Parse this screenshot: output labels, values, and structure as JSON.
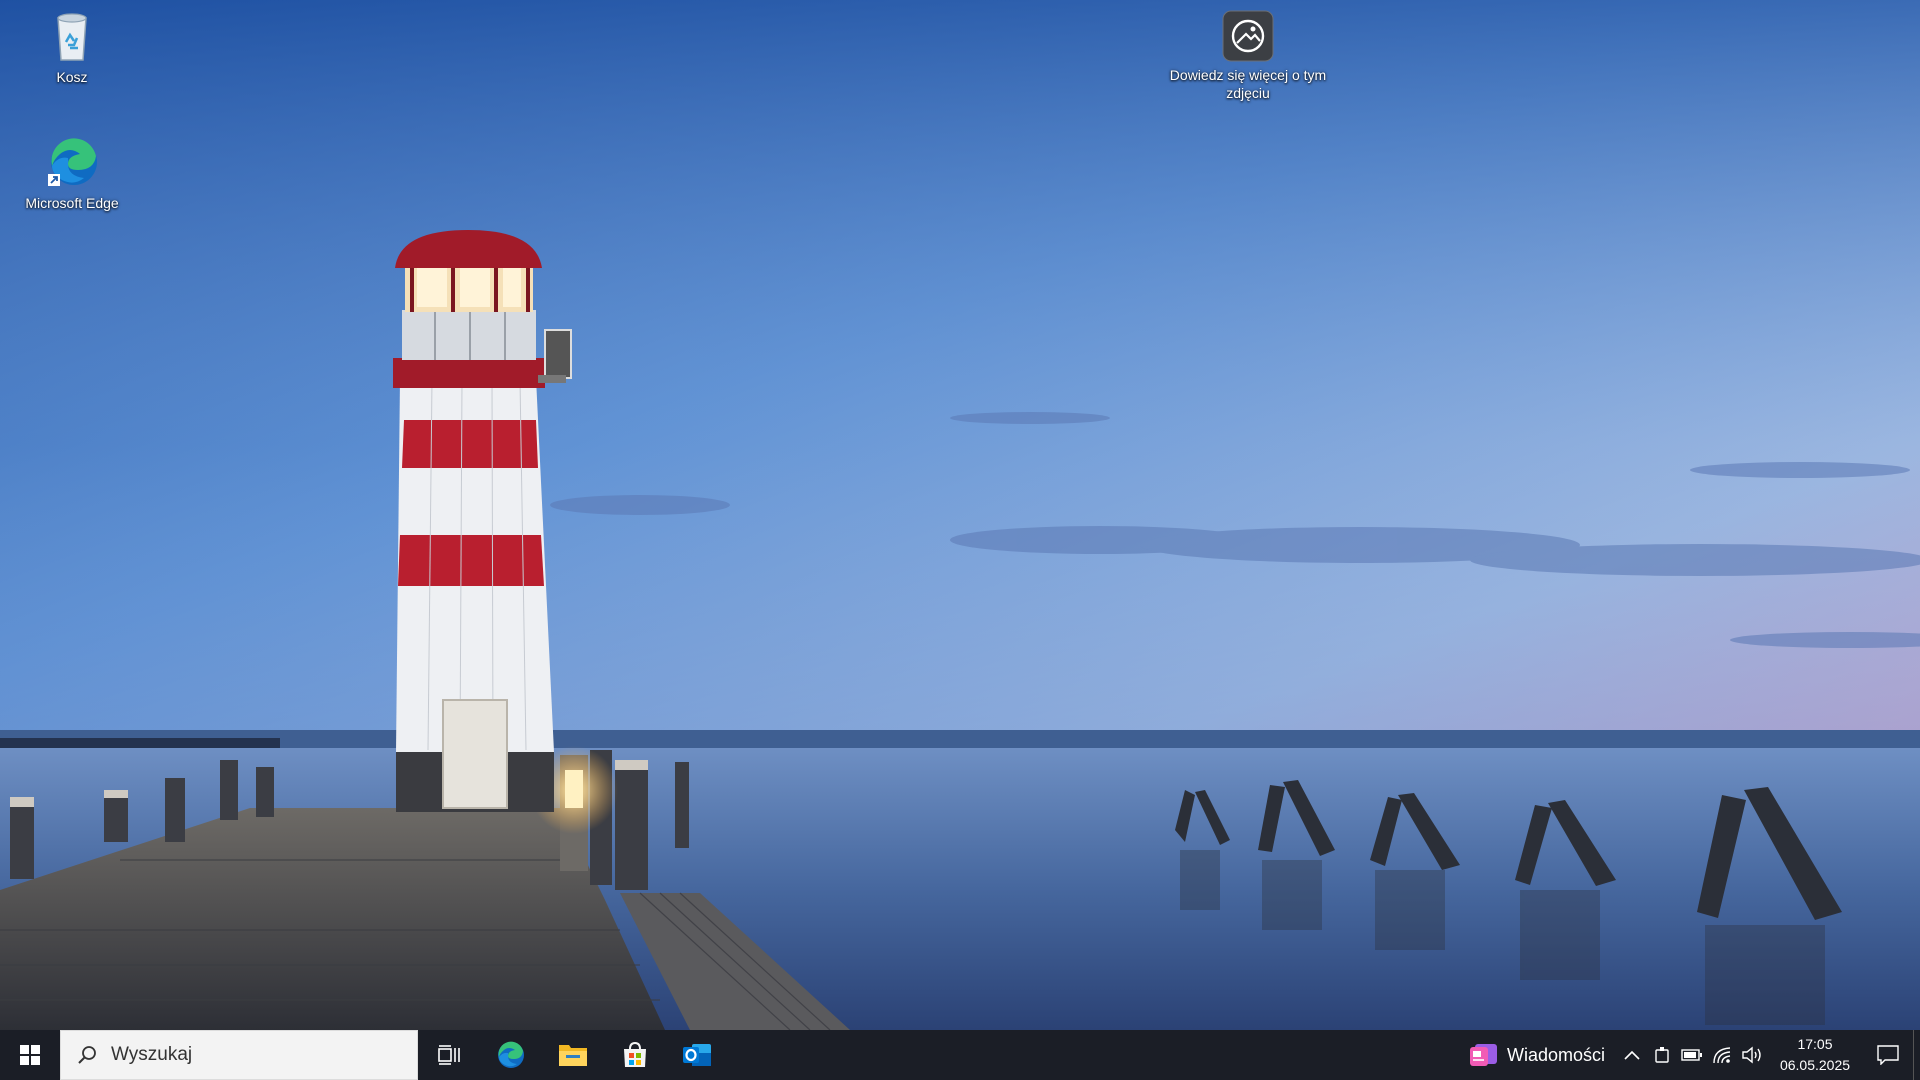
{
  "desktop": {
    "icons": [
      {
        "label": "Kosz",
        "icon": "recycle-bin-icon"
      },
      {
        "label": "Microsoft Edge",
        "icon": "edge-icon"
      },
      {
        "label": "Dowiedz się więcej o tym zdjęciu",
        "icon": "learn-about-picture-icon"
      }
    ],
    "wallpaper": "lighthouse-pier-lake-twilight"
  },
  "taskbar": {
    "search_placeholder": "Wyszukaj",
    "pinned": [
      "task-view-icon",
      "edge-icon",
      "file-explorer-icon",
      "microsoft-store-icon",
      "outlook-icon"
    ],
    "news_label": "Wiadomości",
    "tray": [
      "chevron-up-icon",
      "meet-now-icon",
      "battery-icon",
      "wifi-icon",
      "volume-icon"
    ],
    "time": "17:05",
    "date": "06.05.2025",
    "colors": {
      "taskbar": "#1b1e26",
      "search_bg": "#f3f3f3"
    }
  }
}
